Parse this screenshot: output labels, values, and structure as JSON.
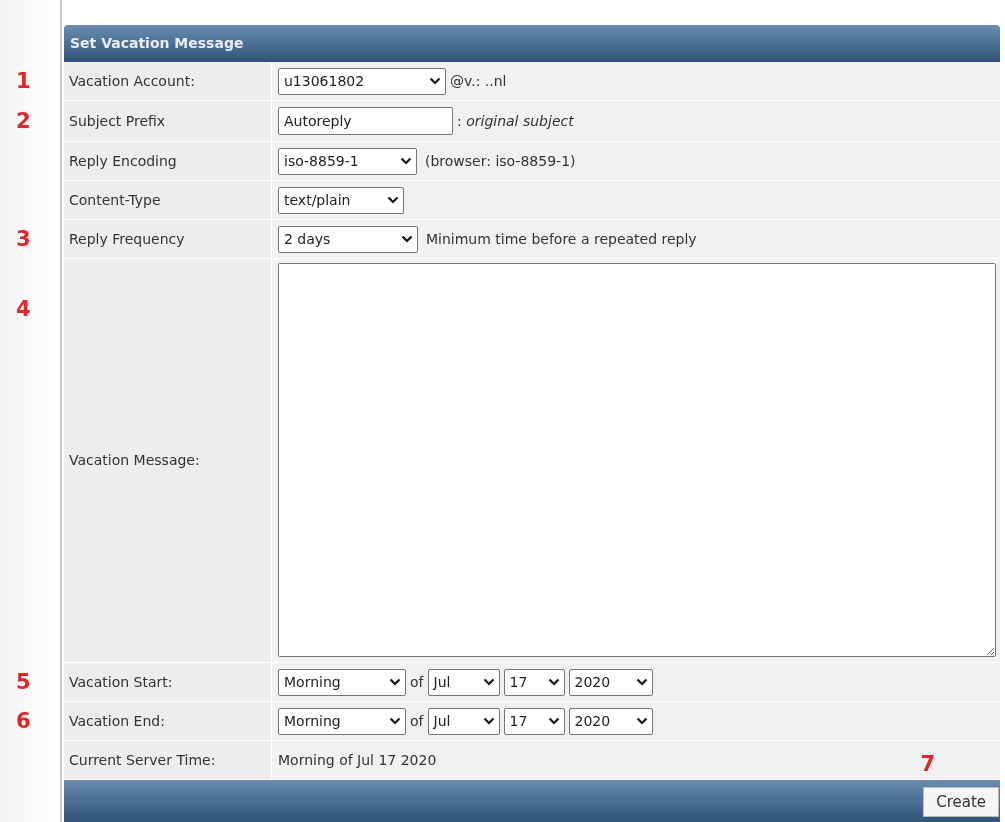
{
  "panel": {
    "title": "Set Vacation Message"
  },
  "rows": [
    {
      "label": "Vacation Account:",
      "marker": "1",
      "controls": [
        {
          "kind": "select",
          "value": "u13061802"
        },
        {
          "kind": "text",
          "text": "@v.: ..nl"
        }
      ]
    },
    {
      "label": "Subject Prefix",
      "marker": "2",
      "controls": [
        {
          "kind": "input",
          "value": "Autoreply"
        },
        {
          "kind": "text",
          "text": ": *original subject*"
        }
      ]
    },
    {
      "label": "Reply Encoding",
      "controls": [
        {
          "kind": "select",
          "value": "iso-8859-1"
        },
        {
          "kind": "text",
          "text": "(browser: iso-8859-1)"
        }
      ]
    },
    {
      "label": "Content-Type",
      "controls": [
        {
          "kind": "select",
          "value": "text/plain"
        }
      ]
    },
    {
      "label": "Reply Frequency",
      "marker": "3",
      "controls": [
        {
          "kind": "select",
          "value": "2 days"
        },
        {
          "kind": "text",
          "text": "Minimum time before a repeated reply"
        }
      ]
    },
    {
      "label": "Vacation Message:",
      "marker": "4",
      "controls": [
        {
          "kind": "textarea"
        }
      ]
    },
    {
      "label": "Vacation Start:",
      "marker": "5",
      "controls": [
        {
          "kind": "select",
          "value": "Morning"
        },
        {
          "kind": "text",
          "text": "of"
        },
        {
          "kind": "select",
          "value": "Jul"
        },
        {
          "kind": "select",
          "value": "17"
        },
        {
          "kind": "select",
          "value": "2020"
        }
      ]
    },
    {
      "label": "Vacation End:",
      "marker": "6",
      "controls": [
        {
          "kind": "select",
          "value": "Morning"
        },
        {
          "kind": "text",
          "text": "of"
        },
        {
          "kind": "select",
          "value": "Jul"
        },
        {
          "kind": "select",
          "value": "17"
        },
        {
          "kind": "select",
          "value": "2020"
        }
      ]
    },
    {
      "label": "Current Server Time:",
      "controls": [
        {
          "kind": "text",
          "text": "Morning of Jul 17 2020"
        }
      ]
    }
  ],
  "footer": {
    "marker": "7",
    "button": "Create"
  }
}
